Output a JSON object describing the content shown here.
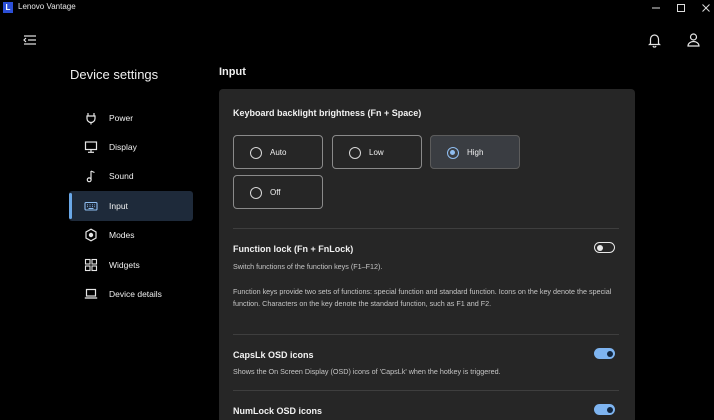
{
  "window": {
    "logo_letter": "L",
    "title": "Lenovo Vantage"
  },
  "sidebar": {
    "title": "Device settings",
    "items": [
      {
        "label": "Power",
        "icon": "power-plug-icon"
      },
      {
        "label": "Display",
        "icon": "monitor-icon"
      },
      {
        "label": "Sound",
        "icon": "music-note-icon"
      },
      {
        "label": "Input",
        "icon": "keyboard-icon",
        "active": true
      },
      {
        "label": "Modes",
        "icon": "hexagon-icon"
      },
      {
        "label": "Widgets",
        "icon": "widgets-icon"
      },
      {
        "label": "Device details",
        "icon": "laptop-icon"
      }
    ]
  },
  "main": {
    "title": "Input",
    "backlight": {
      "title": "Keyboard backlight brightness (Fn + Space)",
      "options": [
        "Auto",
        "Low",
        "High",
        "Off"
      ],
      "selected": "High"
    },
    "function_lock": {
      "title": "Function lock (Fn + FnLock)",
      "desc": "Switch functions of the function keys (F1–F12).",
      "desc2": "Function keys provide two sets of functions: special function and standard function. Icons on the key denote the special function. Characters on the key denote the standard function, such as F1 and F2.",
      "enabled": false
    },
    "capslk": {
      "title": "CapsLk OSD icons",
      "desc": "Shows the On Screen Display (OSD) icons of 'CapsLk' when the hotkey is triggered.",
      "enabled": true
    },
    "numlock": {
      "title": "NumLock OSD icons",
      "enabled": true
    }
  },
  "colors": {
    "accent": "#7eb4f0",
    "background": "#000000",
    "card": "#262626",
    "active_nav": "#1e2a3a"
  }
}
